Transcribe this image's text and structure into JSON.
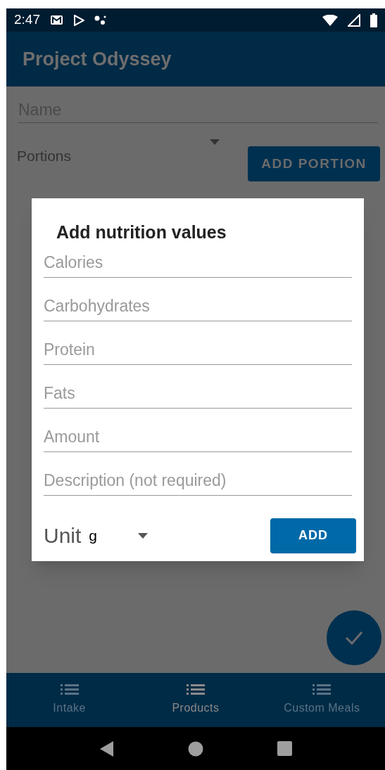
{
  "status_bar": {
    "time": "2:47"
  },
  "app_bar": {
    "title": "Project Odyssey"
  },
  "form": {
    "name_field": {
      "placeholder": "Name"
    },
    "portions_label": "Portions",
    "add_portion_button": "ADD PORTION"
  },
  "dialog": {
    "title": "Add nutrition values",
    "fields": [
      {
        "placeholder": "Calories"
      },
      {
        "placeholder": "Carbohydrates"
      },
      {
        "placeholder": "Protein"
      },
      {
        "placeholder": "Fats"
      },
      {
        "placeholder": "Amount"
      },
      {
        "placeholder": "Description (not required)"
      }
    ],
    "unit_label": "Unit",
    "unit_value": "g",
    "add_button": "ADD"
  },
  "bottom_nav": [
    {
      "label": "Intake",
      "selected": false
    },
    {
      "label": "Products",
      "selected": true
    },
    {
      "label": "Custom Meals",
      "selected": false
    }
  ]
}
